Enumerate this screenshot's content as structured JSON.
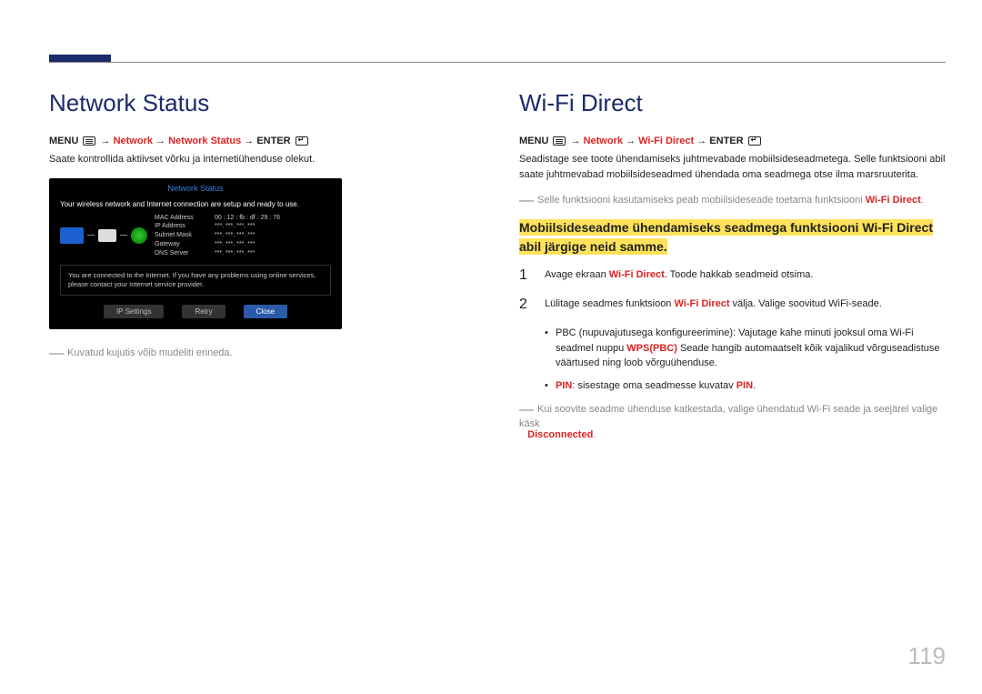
{
  "page_number": "119",
  "left": {
    "heading": "Network Status",
    "menu_prefix": "MENU",
    "menu_path_1": "Network",
    "menu_path_2": "Network Status",
    "menu_enter": "ENTER",
    "desc": "Saate kontrollida aktiivset võrku ja internetiühenduse olekut.",
    "note": "Kuvatud kujutis võib mudeliti erineda.",
    "screenshot": {
      "title": "Network Status",
      "msg1": "Your wireless network and Internet connection are setup and ready to use.",
      "rows": {
        "r1k": "MAC Address",
        "r1v": "00 : 12 : fb : df : 29 : 76",
        "r2k": "IP Address",
        "r2v": "***. ***. ***. ***",
        "r3k": "Subnet Mask",
        "r3v": "***. ***. ***. ***",
        "r4k": "Gateway",
        "r4v": "***. ***. ***. ***",
        "r5k": "DNS Server",
        "r5v": "***. ***. ***. ***"
      },
      "info": "You are connected to the Internet. If you have any problems using online services, please contact your Internet service provider.",
      "btn1": "IP Settings",
      "btn2": "Retry",
      "btn3": "Close"
    }
  },
  "right": {
    "heading": "Wi-Fi Direct",
    "menu_prefix": "MENU",
    "menu_path_1": "Network",
    "menu_path_2": "Wi-Fi Direct",
    "menu_enter": "ENTER",
    "desc": "Seadistage see toote ühendamiseks juhtmevabade mobiilsideseadmetega. Selle funktsiooni abil saate juhtmevabad mobiilsideseadmed ühendada oma seadmega otse ilma marsruuterita.",
    "note_pre": "Selle funktsiooni kasutamiseks peab mobiilsideseade toetama funktsiooni ",
    "note_bold": "Wi-Fi Direct",
    "highlight": "Mobiilsideseadme ühendamiseks seadmega funktsiooni Wi-Fi Direct abil järgige neid samme.",
    "step1_pre": "Avage ekraan ",
    "step1_bold": "Wi-Fi Direct",
    "step1_post": ". Toode hakkab seadmeid otsima.",
    "step2_pre": "Lülitage seadmes funktsioon ",
    "step2_bold": "Wi-Fi Direct",
    "step2_post": " välja. Valige soovitud WiFi-seade.",
    "bullet1_pre": "PBC (nupuvajutusega konfigureerimine): Vajutage kahe minuti jooksul oma Wi-Fi seadmel nuppu ",
    "bullet1_bold": "WPS(PBC)",
    "bullet1_post": " Seade hangib automaatselt kõik vajalikud võrguseadistuse väärtused ning loob võrguühenduse.",
    "bullet2_bold1": "PIN",
    "bullet2_mid": ": sisestage oma seadmesse kuvatav ",
    "bullet2_bold2": "PIN",
    "note2_pre": "Kui soovite seadme ühenduse katkestada, valige ühendatud Wi-Fi seade ja seejärel valige käsk ",
    "note2_bold": "Disconnected"
  }
}
